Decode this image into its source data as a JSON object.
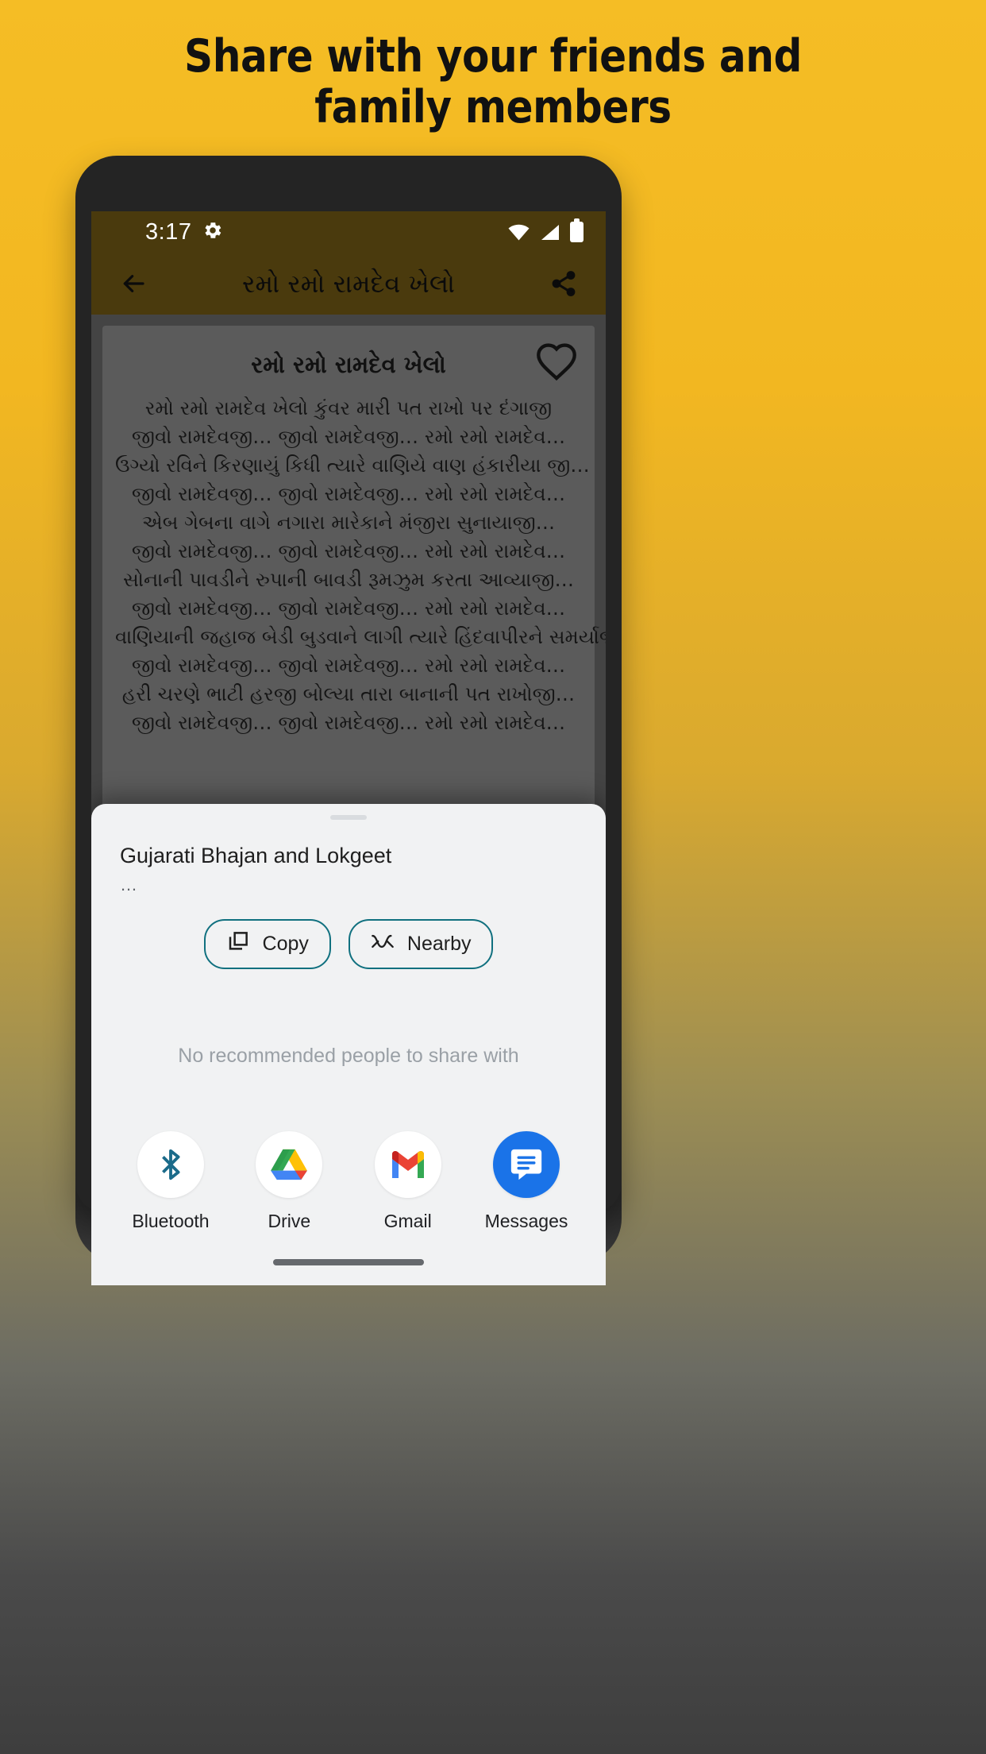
{
  "promo": {
    "headline_line1": "Share with your friends and",
    "headline_line2": "family members"
  },
  "status_bar": {
    "time": "3:17",
    "icons": [
      "gear-icon",
      "wifi-icon",
      "signal-icon",
      "battery-icon"
    ]
  },
  "app_bar": {
    "back_icon": "back-arrow-icon",
    "title": "રમો રમો રામદેવ ખેલો",
    "share_icon": "share-icon"
  },
  "song_card": {
    "title": "રમો રમો રામદેવ ખેલો",
    "favorite_icon": "heart-outline-icon",
    "lyrics": [
      "રમો રમો રામદેવ ખેલો કુંવર મારી પત રાખો પર દંગાજી",
      "જીવો રામદેવજી… જીવો રામદેવજી… રમો રમો રામદેવ…",
      "ઉગ્યો રવિને કિરણાયું કિધી ત્યારે વાણિયે વાણ હંકારીયા જી…",
      "જીવો રામદેવજી… જીવો રામદેવજી… રમો રમો રામદેવ…",
      "એબ ગેબના વાગે નગારા મારેકાને મંજીરા સુનાયાજી…",
      "જીવો રામદેવજી… જીવો રામદેવજી… રમો રમો રામદેવ…",
      "સોનાની પાવડીને રુપાની બાવડી રૂમઝુમ કરતા આવ્યાજી…",
      "જીવો રામદેવજી… જીવો રામદેવજી… રમો રમો રામદેવ…",
      "વાણિયાની જહાજ બેડી બુડવાને લાગી ત્યારે હિંદવાપીરને સમર્યાજી…",
      "જીવો રામદેવજી… જીવો રામદેવજી… રમો રમો રામદેવ…",
      "હરી ચરણે ભાટી હરજી બોલ્યા તારા બાનાની પત રાખોજી…",
      "જીવો રામદેવજી… જીવો રામદેવજી… રમો રમો રામદેવ…"
    ]
  },
  "share_sheet": {
    "title": "Gujarati Bhajan and Lokgeet",
    "subtitle": "…",
    "chips": [
      {
        "label": "Copy",
        "icon": "copy-icon"
      },
      {
        "label": "Nearby",
        "icon": "nearby-share-icon"
      }
    ],
    "empty_state": "No recommended people to share with",
    "apps": [
      {
        "label": "Bluetooth",
        "icon": "bluetooth-icon"
      },
      {
        "label": "Drive",
        "icon": "google-drive-icon"
      },
      {
        "label": "Gmail",
        "icon": "gmail-icon"
      },
      {
        "label": "Messages",
        "icon": "messages-icon"
      }
    ]
  },
  "colors": {
    "promo_bg": "#f2b721",
    "app_bar": "#4a3a0d",
    "card": "#5b5b5b",
    "chip_border": "#10707f",
    "sheet_bg": "#f1f2f3"
  }
}
